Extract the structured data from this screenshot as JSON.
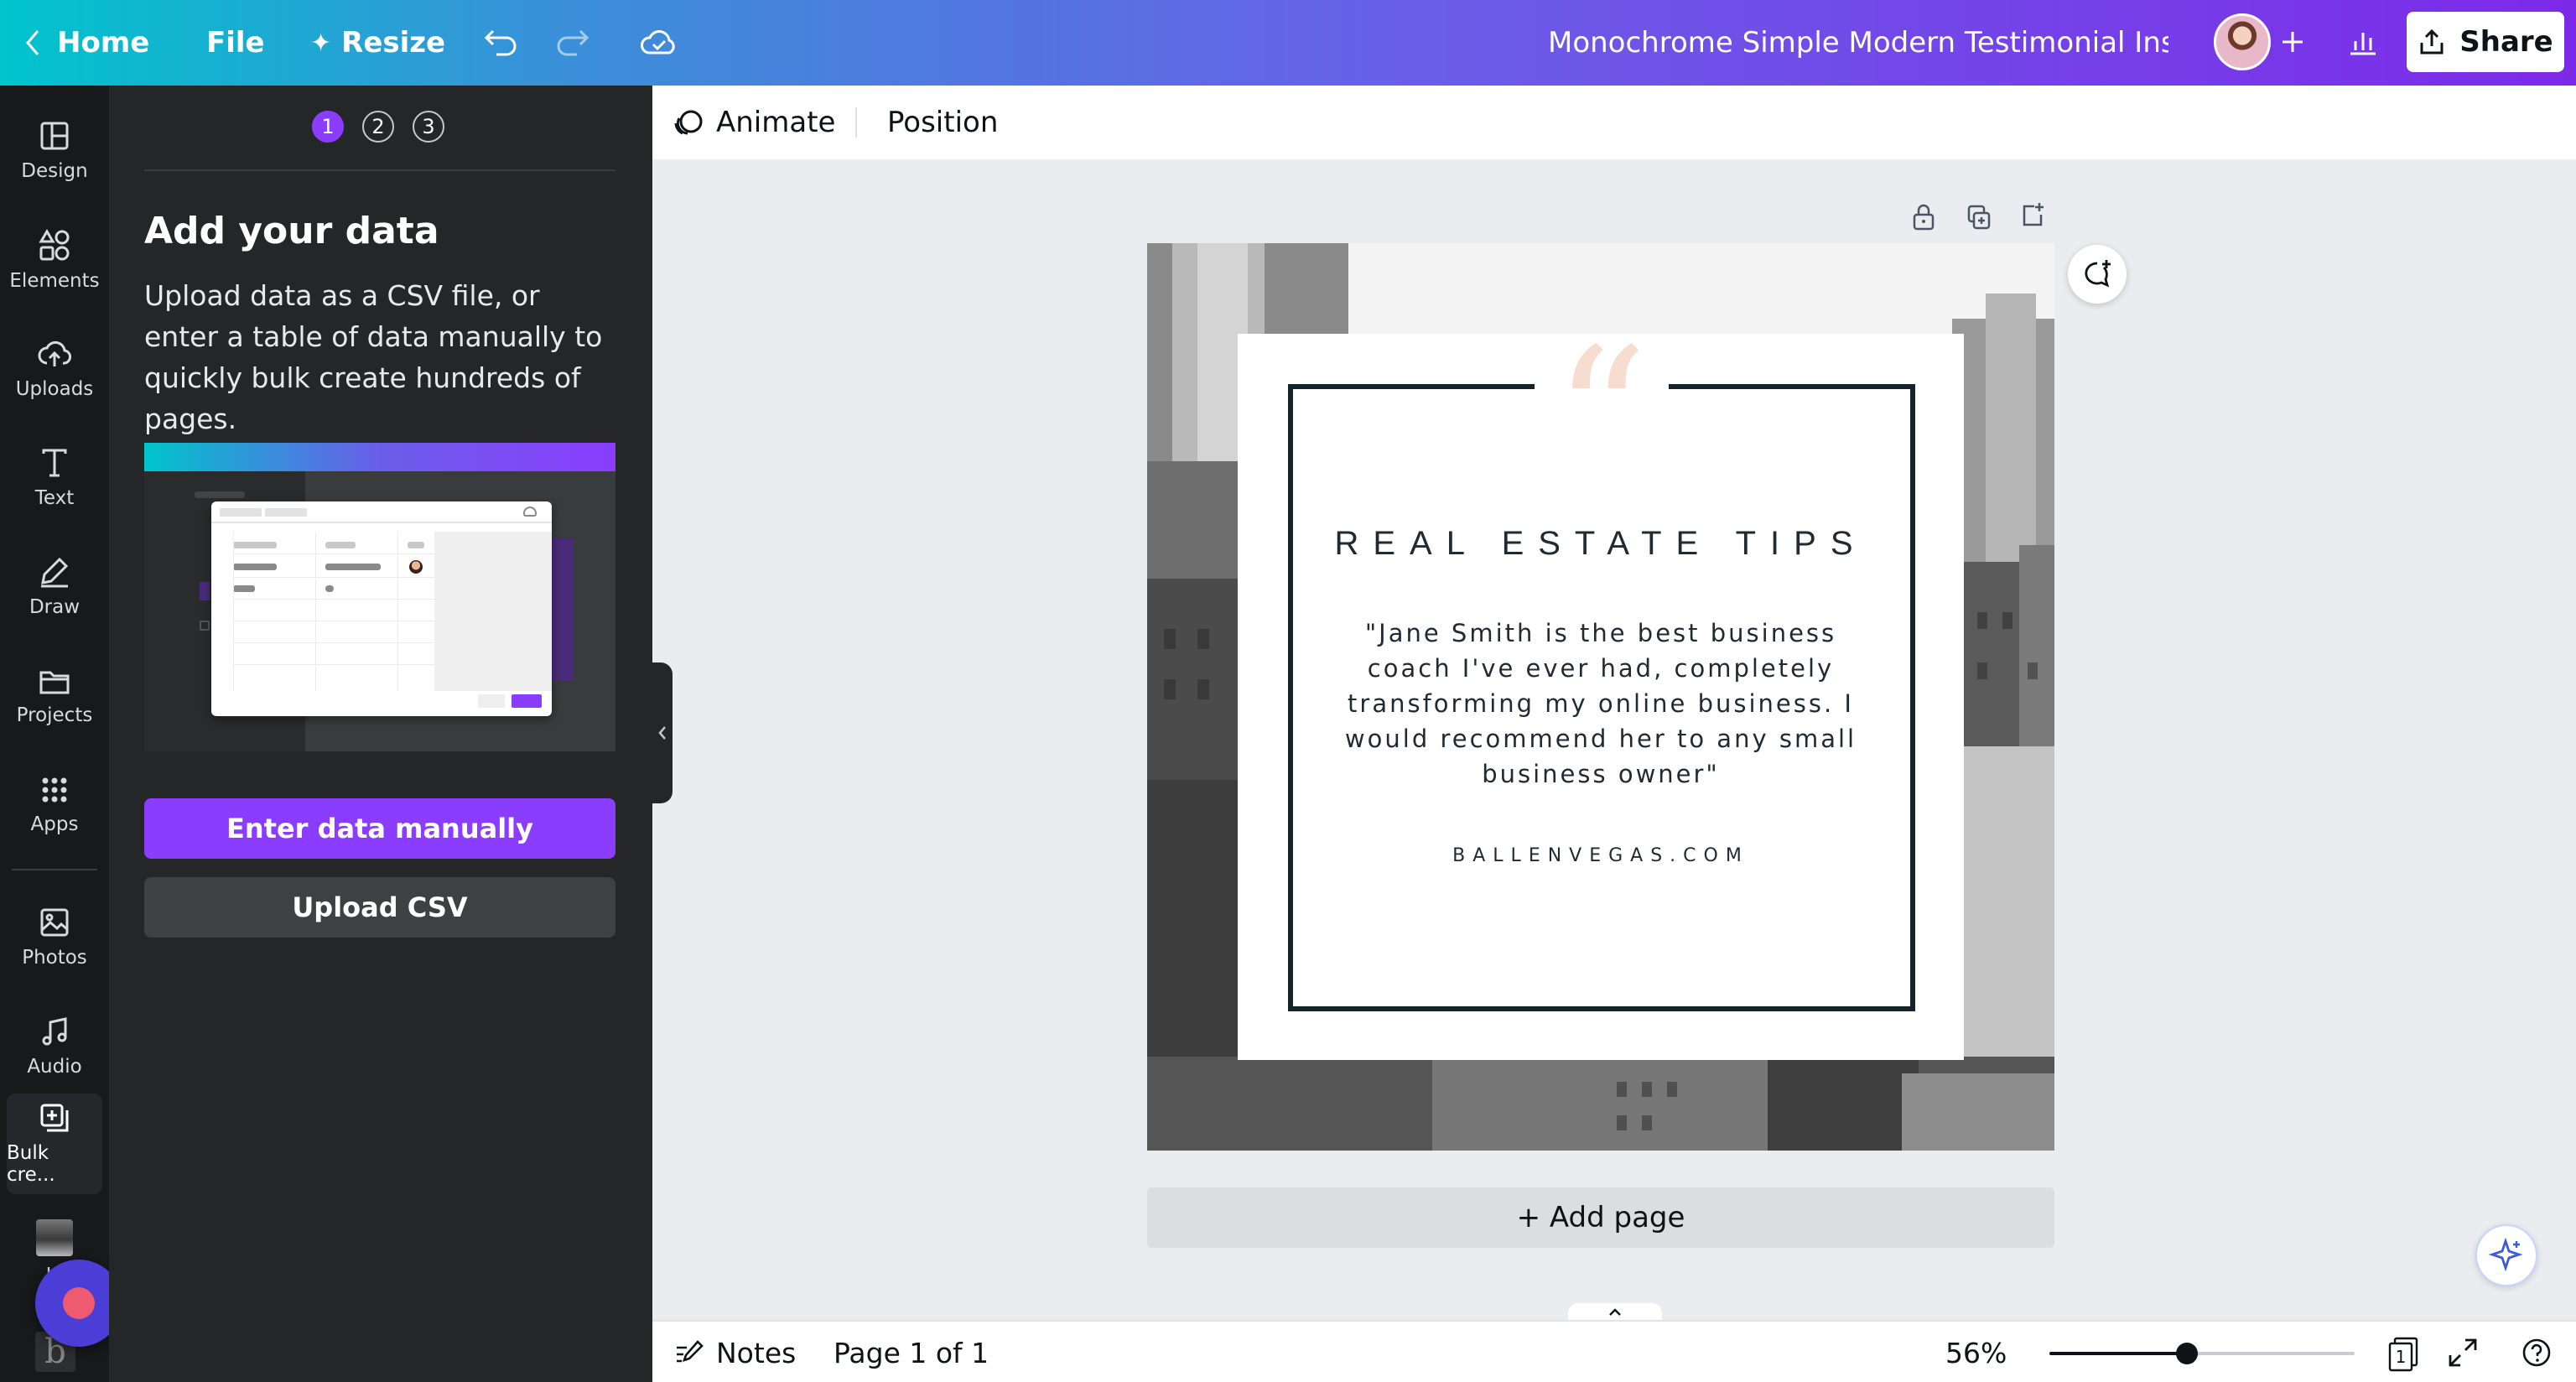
{
  "topbar": {
    "home": "Home",
    "file": "File",
    "resize": "Resize",
    "doc_title": "Monochrome Simple Modern Testimonial Insta...",
    "share": "Share"
  },
  "rail": {
    "items": [
      {
        "label": "Design",
        "icon": "layout-icon"
      },
      {
        "label": "Elements",
        "icon": "shapes-icon"
      },
      {
        "label": "Uploads",
        "icon": "cloud-upload-icon"
      },
      {
        "label": "Text",
        "icon": "text-icon"
      },
      {
        "label": "Draw",
        "icon": "pen-icon"
      },
      {
        "label": "Projects",
        "icon": "folder-icon"
      },
      {
        "label": "Apps",
        "icon": "grid-icon"
      },
      {
        "label": "Photos",
        "icon": "image-icon"
      },
      {
        "label": "Audio",
        "icon": "music-icon"
      },
      {
        "label": "Bulk cre...",
        "icon": "bulk-create-icon"
      },
      {
        "label": "Jo",
        "icon": "user-thumbnail"
      }
    ]
  },
  "panel": {
    "steps": [
      "1",
      "2",
      "3"
    ],
    "heading": "Add your data",
    "description": "Upload data as a CSV file, or enter a table of data manually to quickly bulk create hundreds of pages.",
    "primary_button": "Enter data manually",
    "secondary_button": "Upload CSV"
  },
  "toolbar": {
    "animate": "Animate",
    "position": "Position"
  },
  "design": {
    "quote_mark": "“",
    "title": "REAL ESTATE TIPS",
    "testimonial": "\"Jane Smith is the best business coach I've ever had, completely transforming my online business. I would recommend her to any small business owner\"",
    "website": "BALLENVEGAS.COM",
    "quote_color": "#f6ddd0",
    "frame_color": "#15232d"
  },
  "canvas": {
    "add_page": "+ Add page"
  },
  "footer": {
    "notes": "Notes",
    "page_indicator": "Page 1 of 1",
    "zoom": "56%",
    "zoom_level": 0.56,
    "page_count": "1"
  }
}
